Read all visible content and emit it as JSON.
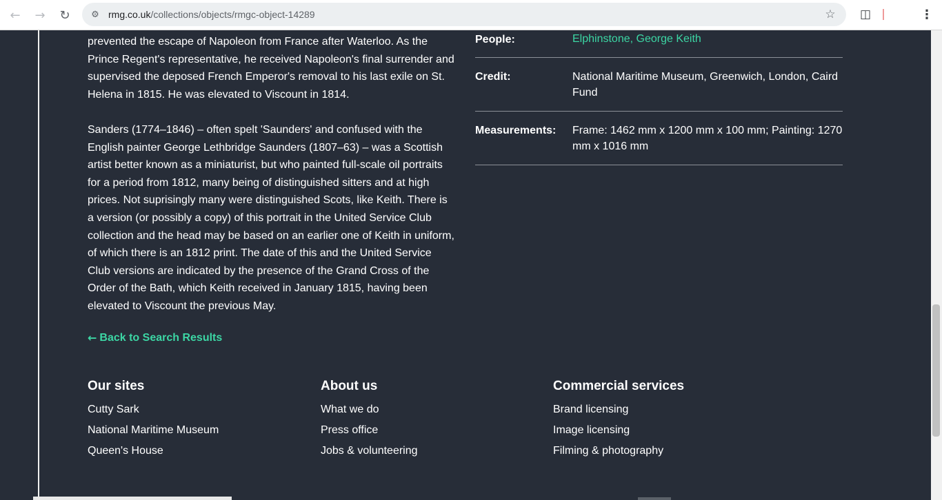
{
  "browser": {
    "url_host": "rmg.co.uk",
    "url_path": "/collections/objects/rmgc-object-14289",
    "icons": {
      "back": "arrow-left-icon",
      "forward": "arrow-right-icon",
      "reload": "reload-icon",
      "site_info": "site-info-icon",
      "bookmark": "star-icon",
      "extensions": "puzzle-icon",
      "menu": "kebab-menu-icon"
    }
  },
  "description": {
    "para1": "prevented the escape of Napoleon from France after Waterloo. As the Prince Regent's representative, he received Napoleon's final surrender and supervised the deposed French Emperor's removal to his last exile on St. Helena in 1815. He was elevated to Viscount in 1814.",
    "para2": "Sanders (1774–1846) – often spelt 'Saunders' and confused with the English painter George Lethbridge Saunders (1807–63) – was a Scottish artist better known as a miniaturist, but who painted full-scale oil portraits for a period from 1812, many being of distinguished sitters and at high prices. Not suprisingly many were distinguished Scots, like Keith. There is a version (or possibly a copy) of this portrait in the United Service Club collection and the head may be based on an earlier one of Keith in uniform, of which there is an 1812 print. The date of this and the United Service Club versions are indicated by the presence of the Grand Cross of the Order of the Bath, which Keith received in January 1815, having been elevated to Viscount the previous May."
  },
  "back_link": {
    "arrow": "←",
    "label": "Back to Search Results"
  },
  "details": {
    "people_label": "People:",
    "people_value": "Elphinstone, George Keith",
    "credit_label": "Credit:",
    "credit_value": "National Maritime Museum, Greenwich, London, Caird Fund",
    "measurements_label": "Measurements:",
    "measurements_value": "Frame: 1462 mm x 1200 mm x 100 mm; Painting: 1270 mm x 1016 mm"
  },
  "footer": {
    "our_sites": {
      "heading": "Our sites",
      "links": [
        "Cutty Sark",
        "National Maritime Museum",
        "Queen's House"
      ]
    },
    "about_us": {
      "heading": "About us",
      "links": [
        "What we do",
        "Press office",
        "Jobs & volunteering"
      ]
    },
    "commercial": {
      "heading": "Commercial services",
      "links": [
        "Brand licensing",
        "Image licensing",
        "Filming & photography"
      ]
    }
  },
  "colors": {
    "page_background": "#272d38",
    "accent": "#3cd6a4",
    "text": "#ffffff",
    "divider": "#8c9198"
  }
}
